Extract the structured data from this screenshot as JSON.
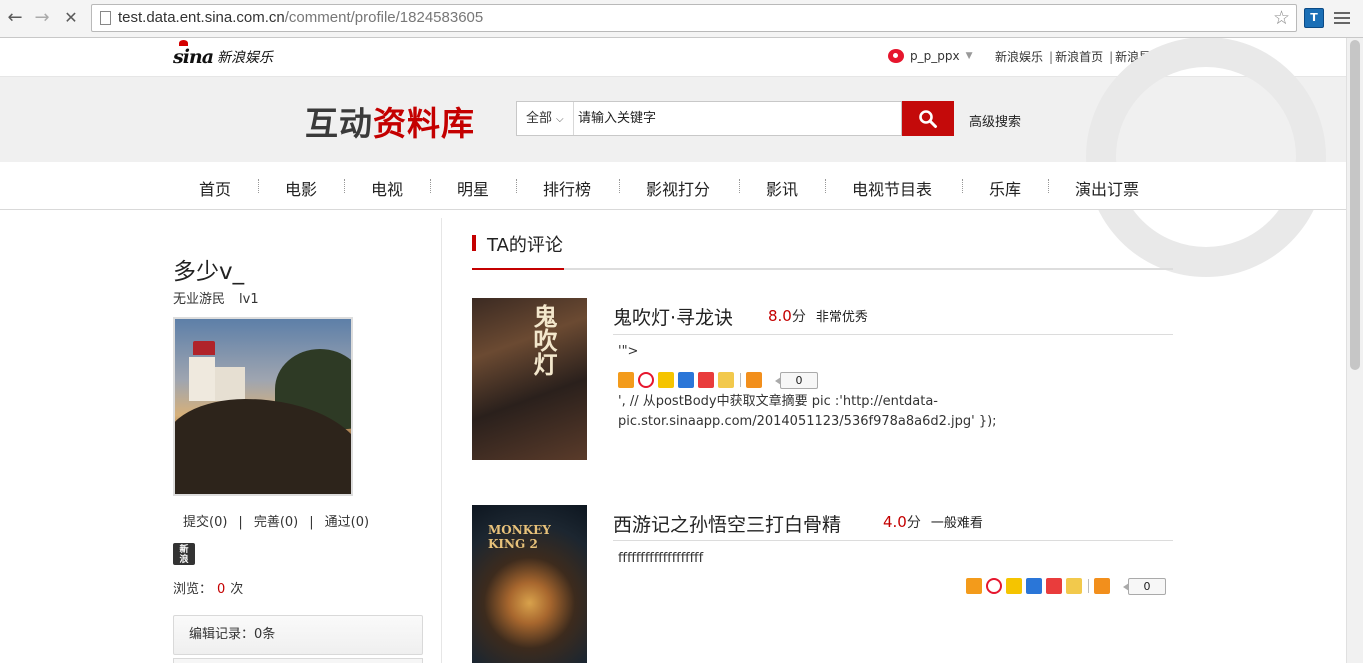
{
  "browser": {
    "url_host": "test.data.ent.sina.com.cn",
    "url_path": "/comment/profile/1824583605",
    "back_glyph": "←",
    "forward_glyph": "→",
    "stop_glyph": "✕",
    "star_glyph": "☆"
  },
  "topbar": {
    "logo_text": "sina",
    "logo_sub": "新浪娱乐",
    "username": "p_p_ppx",
    "links": [
      "新浪娱乐",
      "新浪首页",
      "新浪导航"
    ]
  },
  "header": {
    "title_part1": "互动",
    "title_part2": "资料库",
    "search_category": "全部",
    "search_placeholder": "请输入关键字",
    "advanced_search": "高级搜索"
  },
  "nav": [
    "首页",
    "电影",
    "电视",
    "明星",
    "排行榜",
    "影视打分",
    "影讯",
    "电视节目表",
    "乐库",
    "演出订票"
  ],
  "profile": {
    "name": "多少v_",
    "occupation": "无业游民",
    "level": "lv1",
    "stats": {
      "submit": "提交(0)",
      "improve": "完善(0)",
      "approved": "通过(0)"
    },
    "views_label": "浏览：",
    "views_count": "0",
    "views_unit": "次",
    "edit_record": "编辑记录：0条"
  },
  "comments_section": {
    "title": "TA的评论",
    "items": [
      {
        "title": "鬼吹灯·寻龙诀",
        "score": "8.0",
        "score_unit": "分",
        "rating_label": "非常优秀",
        "body_line1": "'\">",
        "body_line2": "', // 从postBody中获取文章摘要 pic :'http://entdata-",
        "body_line3": "pic.stor.sinaapp.com/2014051123/536f978a8a6d2.jpg' });",
        "share_count": "0",
        "poster_text": "鬼吹灯"
      },
      {
        "title": "西游记之孙悟空三打白骨精",
        "score": "4.0",
        "score_unit": "分",
        "rating_label": "一般难看",
        "body_line1": "fffffffffffffffffff",
        "share_count": "0",
        "poster_text": "MONKEY KING 2"
      }
    ]
  },
  "colors": {
    "brand_red": "#c40000",
    "search_button": "#c40a0a"
  }
}
